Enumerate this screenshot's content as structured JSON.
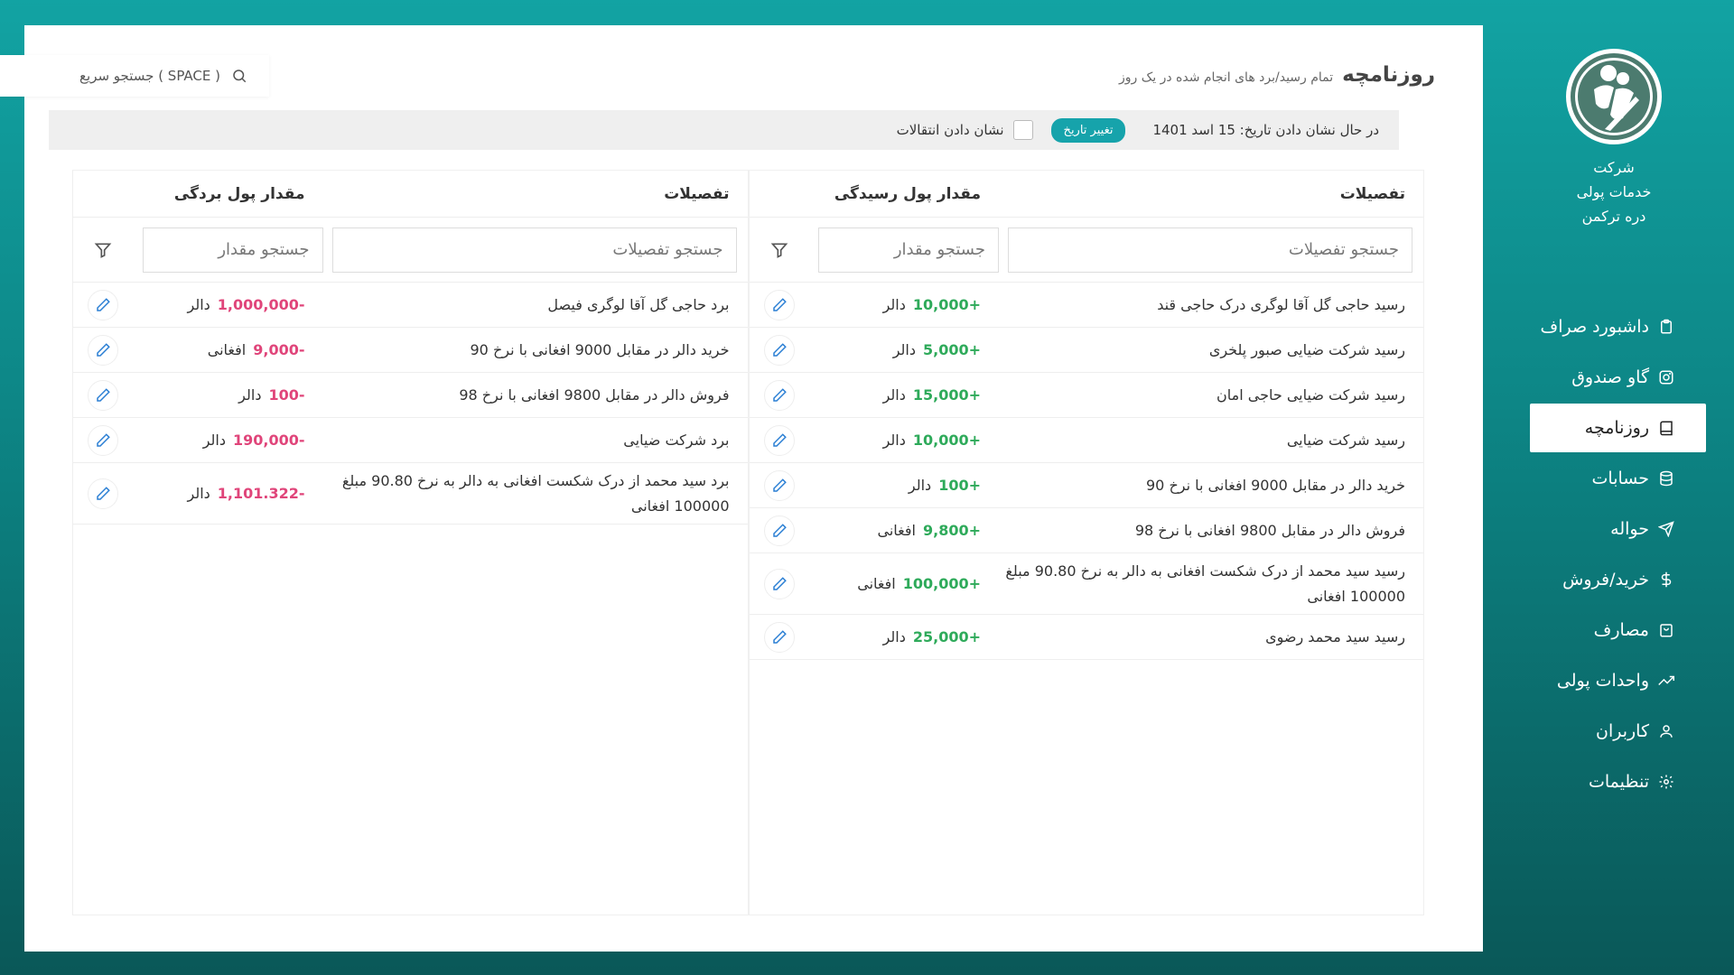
{
  "company": {
    "lines": [
      "شرکت",
      "خدمات پولی",
      "دره ترکمن"
    ]
  },
  "nav": [
    {
      "label": "داشبورد صراف",
      "icon": "clipboard-icon",
      "active": false
    },
    {
      "label": "گاو صندوق",
      "icon": "safe-icon",
      "active": false
    },
    {
      "label": "روزنامچه",
      "icon": "book-icon",
      "active": true
    },
    {
      "label": "حسابات",
      "icon": "database-icon",
      "active": false
    },
    {
      "label": "حواله",
      "icon": "send-icon",
      "active": false
    },
    {
      "label": "خرید/فروش",
      "icon": "dollar-icon",
      "active": false
    },
    {
      "label": "مصارف",
      "icon": "bag-icon",
      "active": false
    },
    {
      "label": "واحدات پولی",
      "icon": "trending-up-icon",
      "active": false
    },
    {
      "label": "کاربران",
      "icon": "user-icon",
      "active": false
    },
    {
      "label": "تنظیمات",
      "icon": "gear-icon",
      "active": false
    }
  ],
  "header": {
    "title": "روزنامچه",
    "subtitle": "تمام رسید/برد های انجام شده در یک روز",
    "quick_search": "جستجو سریع ( SPACE )"
  },
  "filter_bar": {
    "date_text": "در حال نشان دادن تاریخ: 15 اسد 1401",
    "change_date": "تغییر تاریخ",
    "show_transfers": "نشان دادن انتقالات"
  },
  "receipts": {
    "col_details": "تفصیلات",
    "col_amount": "مقدار پول رسیدگی",
    "search_details": "جستجو تفصیلات",
    "search_amount": "جستجو مقدار",
    "rows": [
      {
        "details": "رسید حاجی گل آقا لوگری درک حاجی قند",
        "amount": "+10,000",
        "currency": "دالر"
      },
      {
        "details": "رسید شرکت ضیایی صبور پلخری",
        "amount": "+5,000",
        "currency": "دالر"
      },
      {
        "details": "رسید شرکت ضیایی حاجی امان",
        "amount": "+15,000",
        "currency": "دالر"
      },
      {
        "details": "رسید شرکت ضیایی",
        "amount": "+10,000",
        "currency": "دالر"
      },
      {
        "details": "خرید دالر در مقابل 9000 افغانی با نرخ 90",
        "amount": "+100",
        "currency": "دالر"
      },
      {
        "details": "فروش دالر در مقابل 9800 افغانی با نرخ 98",
        "amount": "+9,800",
        "currency": "افغانی"
      },
      {
        "details": "رسید سید محمد از درک شکست افغانی به دالر به نرخ 90.80 مبلغ 100000 افغانی",
        "amount": "+100,000",
        "currency": "افغانی"
      },
      {
        "details": "رسید سید محمد رضوی",
        "amount": "+25,000",
        "currency": "دالر"
      }
    ]
  },
  "payments": {
    "col_details": "تفصیلات",
    "col_amount": "مقدار پول بردگی",
    "search_details": "جستجو تفصیلات",
    "search_amount": "جستجو مقدار",
    "rows": [
      {
        "details": "برد حاجی گل آقا لوگری فیصل",
        "amount": "-1,000,000",
        "currency": "دالر"
      },
      {
        "details": "خرید دالر در مقابل 9000 افغانی با نرخ 90",
        "amount": "-9,000",
        "currency": "افغانی"
      },
      {
        "details": "فروش دالر در مقابل 9800 افغانی با نرخ 98",
        "amount": "-100",
        "currency": "دالر"
      },
      {
        "details": "برد شرکت ضیایی",
        "amount": "-190,000",
        "currency": "دالر"
      },
      {
        "details": "برد سید محمد از درک شکست افغانی به دالر به نرخ 90.80 مبلغ 100000 افغانی",
        "amount": "-1,101.322",
        "currency": "دالر"
      }
    ]
  },
  "colors": {
    "accent": "#16a3ab",
    "positive": "#2eaa5a",
    "negative": "#e0457a",
    "edit": "#2a7fd4"
  }
}
